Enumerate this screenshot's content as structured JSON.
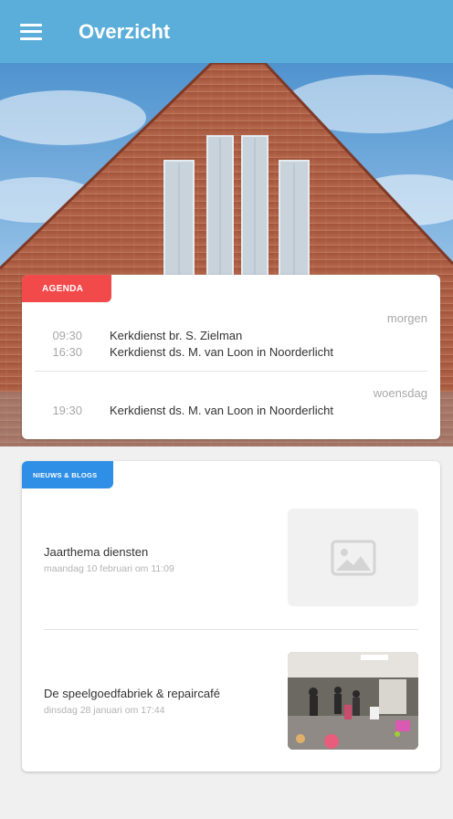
{
  "appbar": {
    "title": "Overzicht",
    "menu_icon": "menu-icon",
    "color": "#5aaed9"
  },
  "agenda": {
    "tag": "AGENDA",
    "tag_color": "#f2494b",
    "groups": [
      {
        "day": "morgen",
        "events": [
          {
            "time": "09:30",
            "title": "Kerkdienst br. S. Zielman"
          },
          {
            "time": "16:30",
            "title": "Kerkdienst ds. M. van Loon in Noorderlicht"
          }
        ]
      },
      {
        "day": "woensdag",
        "events": [
          {
            "time": "19:30",
            "title": "Kerkdienst ds. M. van Loon in Noorderlicht"
          }
        ]
      }
    ]
  },
  "news": {
    "tag": "NIEUWS & BLOGS",
    "tag_color": "#2f8fe6",
    "items": [
      {
        "title": "Jaarthema diensten",
        "date": "maandag 10 februari om 11:09",
        "image": "image-placeholder-icon"
      },
      {
        "title": "De speelgoedfabriek & repaircafé",
        "date": "dinsdag 28 januari om 17:44",
        "image": "photo"
      }
    ]
  }
}
